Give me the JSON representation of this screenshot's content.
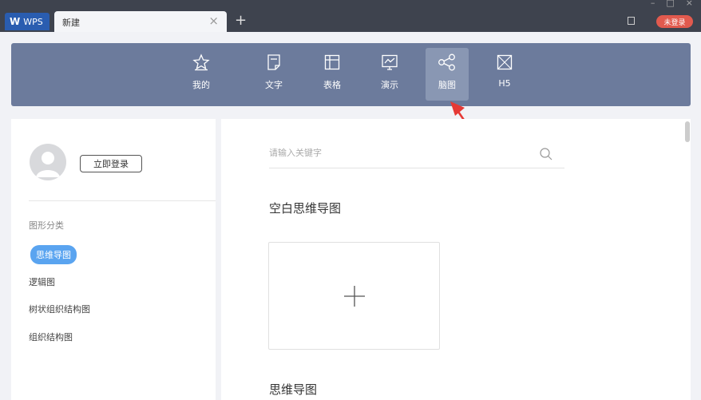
{
  "titlebar": {
    "app_label": "WPS",
    "tab_label": "新建",
    "close_glyph": "×",
    "add_glyph": "+",
    "login_badge": "未登录",
    "win_minimize": "–",
    "win_maximize": "□",
    "win_close": "×"
  },
  "nav": {
    "items": [
      {
        "label": "我的",
        "icon": "star-icon"
      },
      {
        "label": "文字",
        "icon": "document-icon"
      },
      {
        "label": "表格",
        "icon": "table-icon"
      },
      {
        "label": "演示",
        "icon": "presentation-icon"
      },
      {
        "label": "脑图",
        "icon": "mindmap-icon",
        "active": true
      },
      {
        "label": "H5",
        "icon": "h5-icon"
      }
    ]
  },
  "left": {
    "login_button": "立即登录",
    "category_title": "图形分类",
    "categories": [
      "思维导图",
      "逻辑图",
      "树状组织结构图",
      "组织结构图"
    ],
    "active_category": "思维导图"
  },
  "main": {
    "search_placeholder": "请输入关键字",
    "section_blank": "空白思维导图",
    "section_templates": "思维导图"
  },
  "colors": {
    "titlebar": "#3e434e",
    "navbar": "#6c7b9c",
    "nav_active": "#8997b3",
    "active_category": "#5aa4f0",
    "login_badge": "#e15a4e",
    "annotation_arrow": "#e53935"
  }
}
